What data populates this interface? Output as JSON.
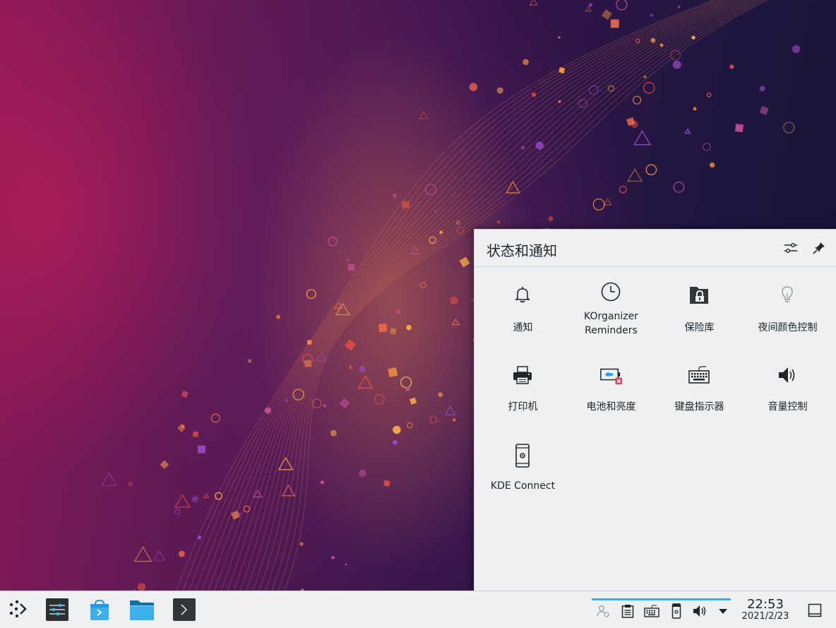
{
  "tray": {
    "title": "状态和通知",
    "items": [
      {
        "label": "通知",
        "icon": "bell-icon"
      },
      {
        "label": "KOrganizer Reminders",
        "icon": "clock-icon"
      },
      {
        "label": "保险库",
        "icon": "vault-icon"
      },
      {
        "label": "夜间颜色控制",
        "icon": "lightbulb-icon"
      },
      {
        "label": "打印机",
        "icon": "printer-icon"
      },
      {
        "label": "电池和亮度",
        "icon": "battery-icon"
      },
      {
        "label": "键盘指示器",
        "icon": "keyboard-icon"
      },
      {
        "label": "音量控制",
        "icon": "speaker-icon"
      },
      {
        "label": "KDE Connect",
        "icon": "phone-icon"
      }
    ]
  },
  "taskbar": {
    "launchers": [
      "application-launcher-icon",
      "system-settings-icon",
      "discover-store-icon",
      "dolphin-folder-icon",
      "konsole-terminal-icon"
    ],
    "clock_time": "22:53",
    "clock_date": "2021/2/23"
  },
  "colors": {
    "accent": "#3daee9",
    "panel": "#eff0f1",
    "text": "#232629",
    "battery_error": "#da4453"
  }
}
